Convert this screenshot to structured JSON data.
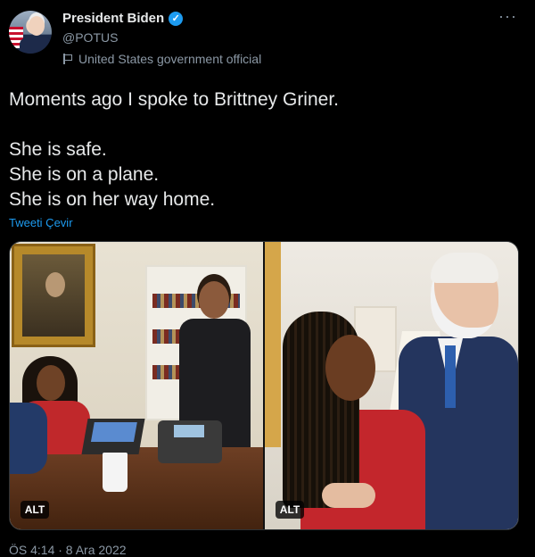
{
  "tweet": {
    "author_name": "President Biden",
    "handle": "@POTUS",
    "affiliation": "United States government official",
    "more_label": "···",
    "verified_glyph": "✓",
    "lines": [
      "Moments ago I spoke to Brittney Griner.",
      "She is safe.",
      "She is on a plane.",
      "She is on her way home."
    ],
    "translate_label": "Tweeti Çevir",
    "timestamp": "ÖS 4:14 · 8 Ara 2022"
  },
  "media": {
    "photos": [
      {
        "alt_label": "ALT"
      },
      {
        "alt_label": "ALT"
      }
    ]
  },
  "icons": {
    "verified": "verified-badge-icon",
    "affiliation": "flag-icon",
    "more": "more-options-icon"
  },
  "colors": {
    "background": "#000000",
    "text": "#e7e9ea",
    "secondary_text": "#8b98a5",
    "accent": "#1d9bf0"
  }
}
